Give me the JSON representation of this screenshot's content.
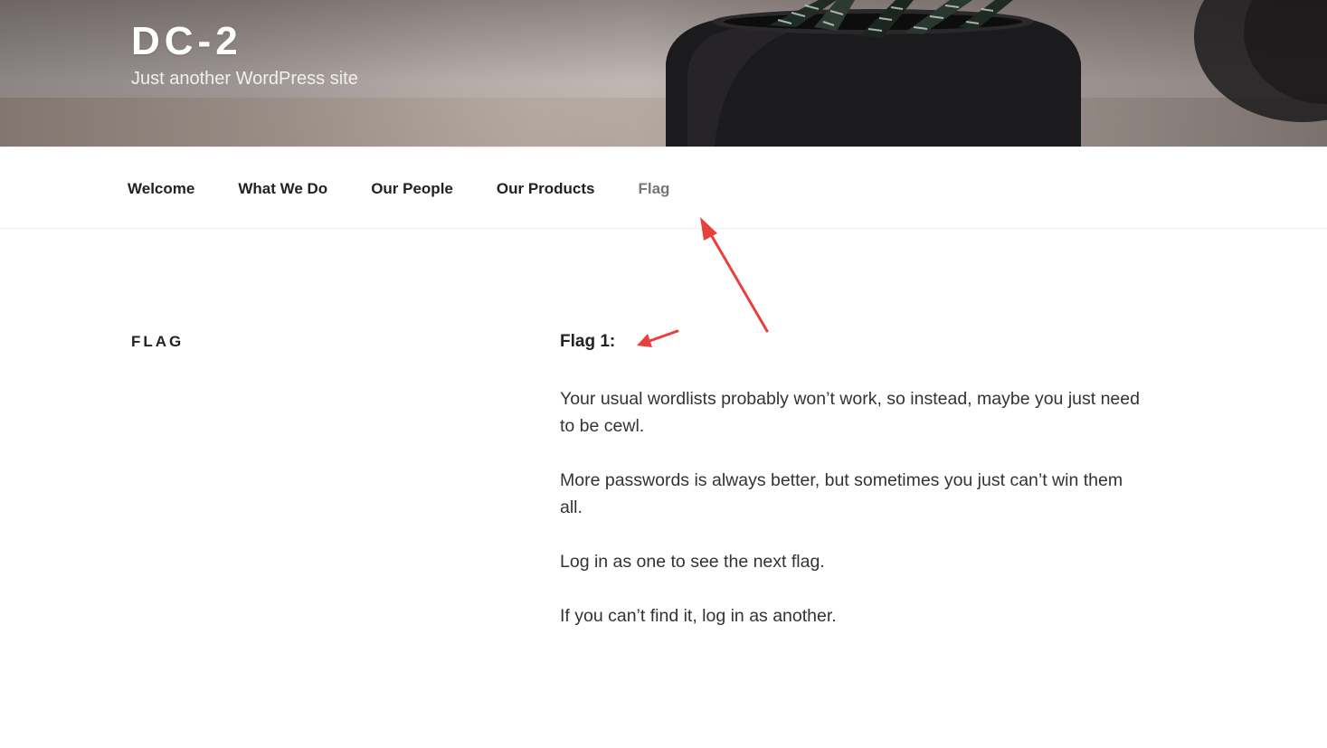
{
  "header": {
    "site_title": "DC-2",
    "site_description": "Just another WordPress site"
  },
  "nav": {
    "items": [
      {
        "label": "Welcome"
      },
      {
        "label": "What We Do"
      },
      {
        "label": "Our People"
      },
      {
        "label": "Our Products"
      },
      {
        "label": "Flag",
        "current": true
      }
    ]
  },
  "page": {
    "title": "FLAG",
    "heading": "Flag 1:",
    "paragraphs": [
      "Your usual wordlists probably won’t work, so instead, maybe you just need to be cewl.",
      "More passwords is always better, but sometimes you just can’t win them all.",
      "Log in as one to see the next flag.",
      "If you can’t find it, log in as another."
    ]
  },
  "colors": {
    "annotation_arrow": "#e8403c",
    "nav_current": "#767676",
    "text": "#222222"
  }
}
